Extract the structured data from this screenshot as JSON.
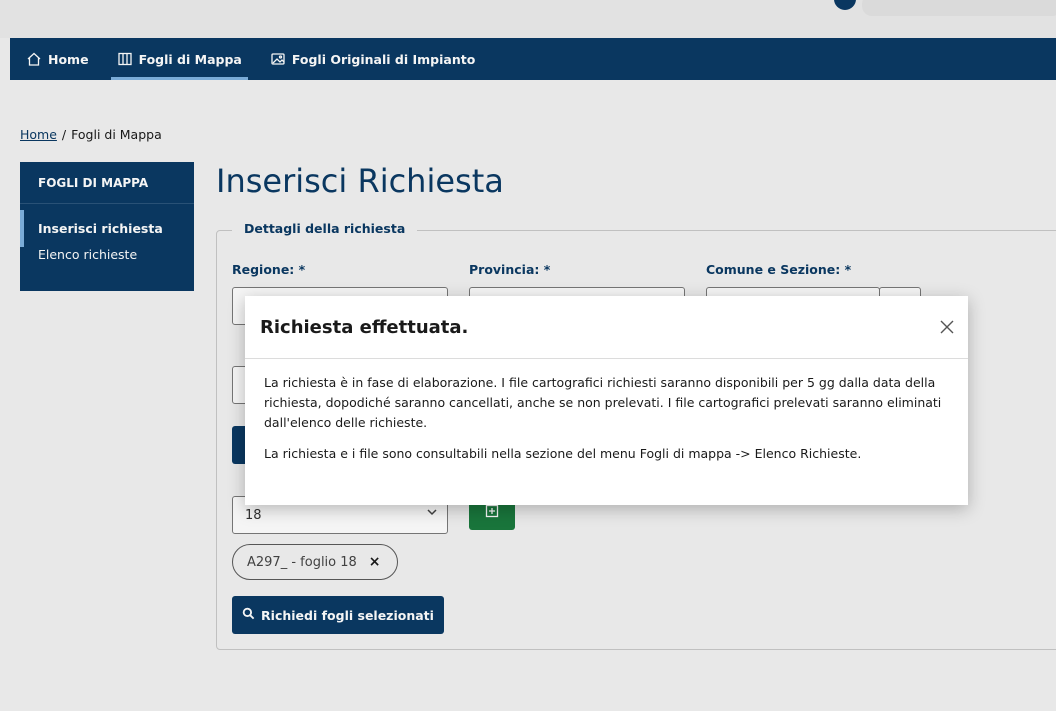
{
  "nav": {
    "items": [
      {
        "label": "Home",
        "icon": "home-icon"
      },
      {
        "label": "Fogli di Mappa",
        "icon": "map-icon"
      },
      {
        "label": "Fogli Originali di Impianto",
        "icon": "image-icon"
      }
    ]
  },
  "breadcrumb": {
    "home": "Home",
    "separator": "/",
    "current": "Fogli di Mappa"
  },
  "sidebar": {
    "title": "FOGLI DI MAPPA",
    "items": [
      {
        "label": "Inserisci richiesta"
      },
      {
        "label": "Elenco richieste"
      }
    ]
  },
  "page": {
    "title": "Inserisci Richiesta"
  },
  "form": {
    "legend": "Dettagli della richiesta",
    "regione_label": "Regione: *",
    "provincia_label": "Provincia: *",
    "comune_label": "Comune e Sezione: *",
    "foglio_value": "18",
    "chip_label": "A297_ - foglio 18",
    "chip_close": "×",
    "submit_label": "Richiedi fogli selezionati"
  },
  "modal": {
    "title": "Richiesta effettuata.",
    "close_glyph": "×",
    "paragraph1": "La richiesta è in fase di elaborazione. I file cartografici richiesti saranno disponibili per 5 gg dalla data della richiesta, dopodiché saranno cancellati, anche se non prelevati. I file cartografici prelevati saranno eliminati dall'elenco delle richieste.",
    "paragraph2": "La richiesta e i file sono consultabili nella sezione del menu Fogli di mappa -> Elenco Richieste."
  },
  "colors": {
    "primary": "#0b3a64",
    "success": "#1b7a3e",
    "accent": "#7fb2e0"
  }
}
